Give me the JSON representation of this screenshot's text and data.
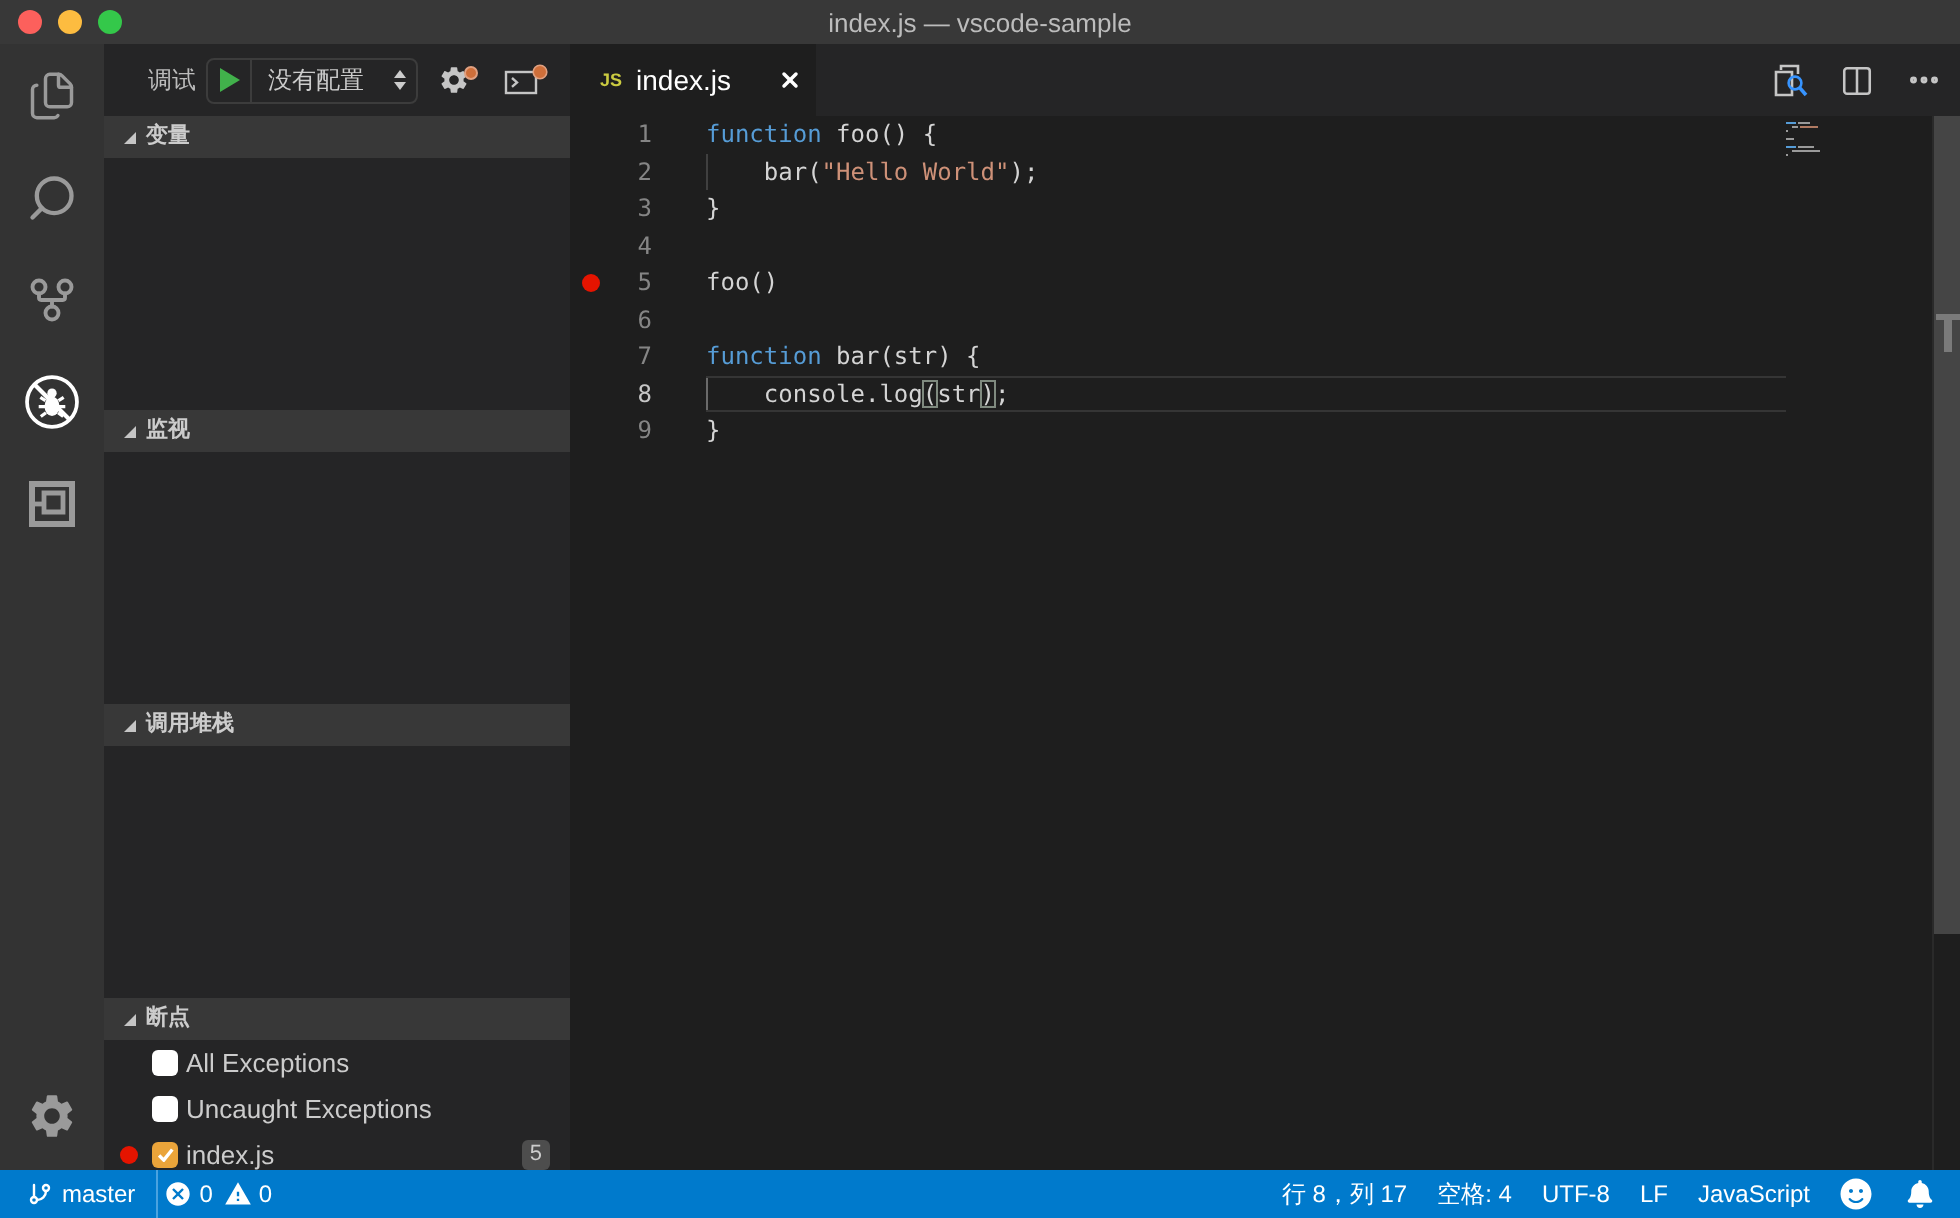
{
  "window": {
    "title": "index.js — vscode-sample"
  },
  "activity_bar": {
    "items": [
      {
        "kind": "explorer",
        "selected": false
      },
      {
        "kind": "search",
        "selected": false
      },
      {
        "kind": "source-control",
        "selected": false
      },
      {
        "kind": "debug",
        "selected": true
      },
      {
        "kind": "extensions",
        "selected": false
      }
    ]
  },
  "debug_toolbar": {
    "label": "调试",
    "configuration": "没有配置"
  },
  "sidebar": {
    "sections": [
      {
        "title": "变量",
        "expanded": true
      },
      {
        "title": "监视",
        "expanded": true
      },
      {
        "title": "调用堆栈",
        "expanded": true
      },
      {
        "title": "断点",
        "expanded": true,
        "items": [
          {
            "label": "All Exceptions",
            "checked": false,
            "breakpoint": false
          },
          {
            "label": "Uncaught Exceptions",
            "checked": false,
            "breakpoint": false
          },
          {
            "label": "index.js",
            "checked": true,
            "breakpoint": true,
            "line": "5"
          }
        ]
      }
    ]
  },
  "editor": {
    "tabs": [
      {
        "icon_text": "JS",
        "label": "index.js",
        "selected": true
      }
    ],
    "lines": [
      {
        "number": "1",
        "breakpoint": false,
        "current": false,
        "indent_guide": false,
        "tokens": [
          {
            "kind": "keyword",
            "text": "function"
          },
          {
            "kind": "plain",
            "text": " foo() {"
          }
        ]
      },
      {
        "number": "2",
        "breakpoint": false,
        "current": false,
        "indent_guide": true,
        "tokens": [
          {
            "kind": "plain",
            "text": "    bar("
          },
          {
            "kind": "string",
            "text": "\"Hello World\""
          },
          {
            "kind": "plain",
            "text": ");"
          }
        ]
      },
      {
        "number": "3",
        "breakpoint": false,
        "current": false,
        "indent_guide": false,
        "tokens": [
          {
            "kind": "plain",
            "text": "}"
          }
        ]
      },
      {
        "number": "4",
        "breakpoint": false,
        "current": false,
        "indent_guide": false
      },
      {
        "number": "5",
        "breakpoint": true,
        "current": false,
        "indent_guide": false,
        "tokens": [
          {
            "kind": "plain",
            "text": "foo()"
          }
        ]
      },
      {
        "number": "6",
        "breakpoint": false,
        "current": false,
        "indent_guide": false
      },
      {
        "number": "7",
        "breakpoint": false,
        "current": false,
        "indent_guide": false,
        "tokens": [
          {
            "kind": "keyword",
            "text": "function"
          },
          {
            "kind": "plain",
            "text": " bar(str) {"
          }
        ]
      },
      {
        "number": "8",
        "breakpoint": false,
        "current": true,
        "indent_guide": true,
        "tokens": [
          {
            "kind": "plain",
            "text": "    console.log"
          },
          {
            "kind": "bracket-match",
            "text": "("
          },
          {
            "kind": "plain",
            "text": "str"
          },
          {
            "kind": "bracket-match",
            "text": ")"
          },
          {
            "kind": "plain",
            "text": ";"
          }
        ]
      },
      {
        "number": "9",
        "breakpoint": false,
        "current": false,
        "indent_guide": false,
        "tokens": [
          {
            "kind": "plain",
            "text": "}"
          }
        ]
      }
    ]
  },
  "status_bar": {
    "branch": "master",
    "errors": "0",
    "warnings": "0",
    "items": [
      "行 8，列 17",
      "空格: 4",
      "UTF-8",
      "LF",
      "JavaScript"
    ]
  }
}
